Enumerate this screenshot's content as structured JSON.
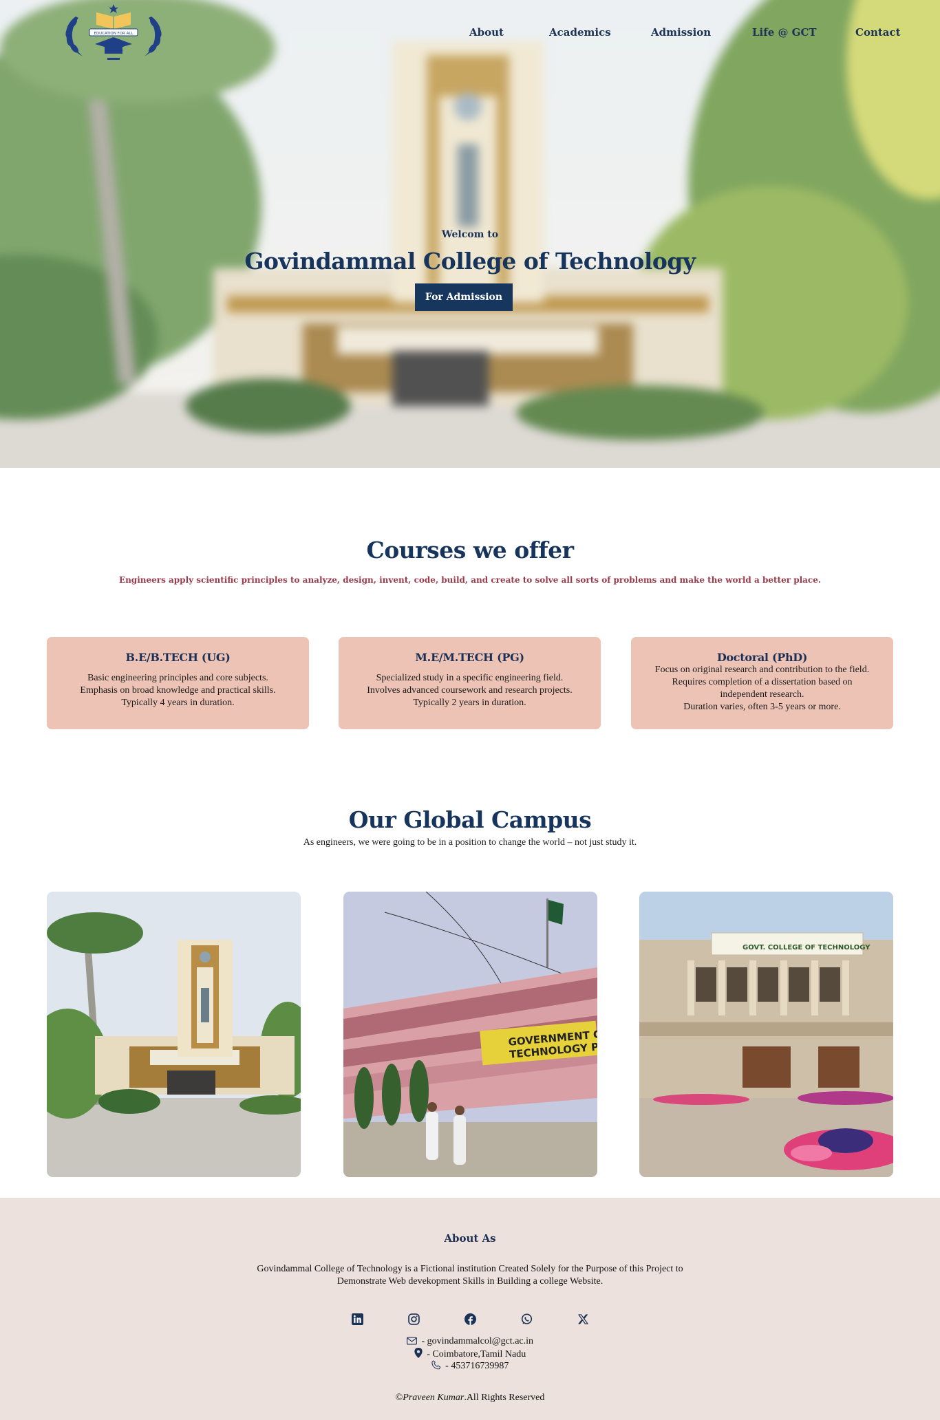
{
  "nav": {
    "items": [
      "About",
      "Academics",
      "Admission",
      "Life @ GCT",
      "Contact"
    ]
  },
  "logo": {
    "text": "EDUCATION FOR ALL"
  },
  "hero": {
    "welcome": "Welcom to",
    "title": "Govindammal College of Technology",
    "button_label": "For Admission"
  },
  "courses": {
    "title": "Courses we offer",
    "subtitle": "Engineers apply scientific principles to analyze, design, invent, code, build, and create to solve all sorts of problems and make the world a better place.",
    "cards": [
      {
        "title": "B.E/B.TECH (UG)",
        "lines": [
          "Basic engineering principles and core subjects.",
          "Emphasis on broad knowledge and practical skills.",
          "Typically 4 years in duration."
        ]
      },
      {
        "title": "M.E/M.TECH (PG)",
        "lines": [
          "Specialized study in a specific engineering field.",
          "Involves advanced coursework and research projects.",
          "Typically 2 years in duration."
        ]
      },
      {
        "title": "Doctoral (PhD)",
        "lines": [
          "Focus on original research and contribution to the field.",
          "Requires completion of a dissertation based on",
          "independent research.",
          "Duration varies, often 3-5 years or more."
        ]
      }
    ]
  },
  "campus": {
    "title": "Our Global Campus",
    "subtitle": "As engineers, we were going to be in a position to change the world – not just study it.",
    "photo2_sign": "GOVERNMENT CO TECHNOLOGY PI",
    "photo3_sign": "GOVT. COLLEGE OF TECHNOLOGY"
  },
  "footer": {
    "title": "About As",
    "text_line1": "Govindammal College of Technology is a Fictional institution Created Solely for the Purpose of this Project to",
    "text_line2": "Demonstrate Web devekopment Skills in Building a college Website.",
    "social": [
      "linkedin-icon",
      "instagram-icon",
      "facebook-icon",
      "whatsapp-icon",
      "x-icon"
    ],
    "email": " - govindammalcol@gct.ac.in",
    "location": " - Coimbatore,Tamil Nadu",
    "phone": " - 453716739987",
    "copyright_symbol": "©",
    "copyright_name": "Praveen Kumar",
    "copyright_rest": ".All Rights Reserved"
  },
  "colors": {
    "navy": "#17345c",
    "card_bg": "#ecc3b5",
    "subtitle_red": "#9a3a4a",
    "footer_bg": "#ece1dc"
  }
}
